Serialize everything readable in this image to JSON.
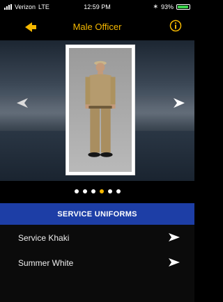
{
  "status": {
    "carrier": "Verizon",
    "network": "LTE",
    "time": "12:59 PM",
    "battery": "93%",
    "battery_level": 0.93,
    "icons": [
      "signal-icon",
      "bluetooth-icon",
      "battery-icon"
    ]
  },
  "nav": {
    "title": "Male Officer",
    "back_icon": "back-arrow-icon",
    "info_icon": "info-icon"
  },
  "gallery": {
    "page_count": 6,
    "active_index": 3
  },
  "section": {
    "title": "SERVICE UNIFORMS"
  },
  "items": [
    {
      "label": "Service Khaki"
    },
    {
      "label": "Summer White"
    }
  ],
  "colors": {
    "accent": "#f5b800",
    "header_bg": "#1d3ea6",
    "background": "#000000"
  }
}
